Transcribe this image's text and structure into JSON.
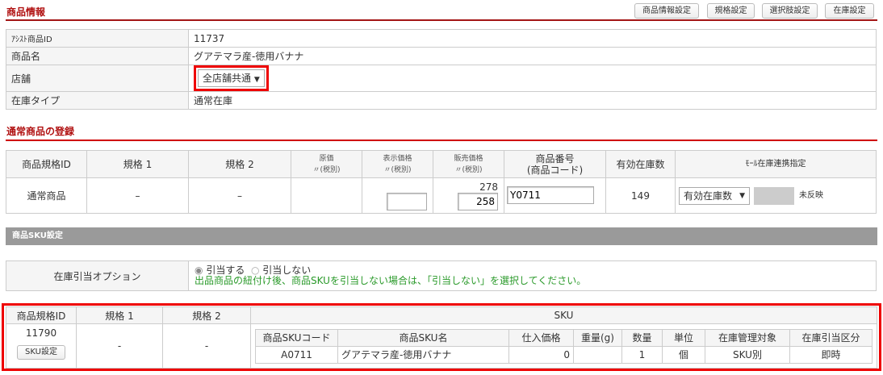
{
  "product_info": {
    "title": "商品情報",
    "buttons": [
      "商品情報設定",
      "規格設定",
      "選択肢設定",
      "在庫設定"
    ],
    "rows": [
      {
        "label": "ｱｼｽﾄ商品ID",
        "value": "11737"
      },
      {
        "label": "商品名",
        "value": "グアテマラ産-徳用バナナ"
      },
      {
        "label": "店舗",
        "value": "全店舗共通"
      },
      {
        "label": "在庫タイプ",
        "value": "通常在庫"
      }
    ]
  },
  "registration": {
    "title": "通常商品の登録",
    "headers": {
      "id": "商品規格ID",
      "spec1": "規格 1",
      "spec2": "規格 2",
      "cost": "原価",
      "cost_sub": "〃(税別)",
      "display": "表示価格",
      "display_sub": "〃(税別)",
      "sale": "販売価格",
      "sale_sub": "〃(税別)",
      "code": "商品番号",
      "code_sub": "(商品コード)",
      "stock": "有効在庫数",
      "mall": "ﾓｰﾙ在庫連携指定"
    },
    "row": {
      "id": "通常商品",
      "spec1": "–",
      "spec2": "–",
      "cost": "",
      "display": "",
      "sale_ref": "278",
      "sale": "258",
      "code": "Y0711",
      "stock": "149",
      "mall_select": "有効在庫数",
      "mall_status": "未反映"
    }
  },
  "sku_settings": {
    "title": "商品SKU設定",
    "option_label": "在庫引当オプション",
    "radio_on": "引当する",
    "radio_off": "引当しない",
    "note": "出品商品の紐付け後、商品SKUを引当しない場合は、「引当しない」を選択してください。",
    "headers": {
      "id": "商品規格ID",
      "spec1": "規格 1",
      "spec2": "規格 2",
      "sku": "SKU"
    },
    "row": {
      "id": "11790",
      "spec1": "-",
      "spec2": "-",
      "button": "SKU設定"
    },
    "sku_headers": [
      "商品SKUコード",
      "商品SKU名",
      "仕入価格",
      "重量(g)",
      "数量",
      "単位",
      "在庫管理対象",
      "在庫引当区分"
    ],
    "sku_row": [
      "A0711",
      "グアテマラ産-徳用バナナ",
      "0",
      "",
      "1",
      "個",
      "SKU別",
      "即時"
    ]
  }
}
